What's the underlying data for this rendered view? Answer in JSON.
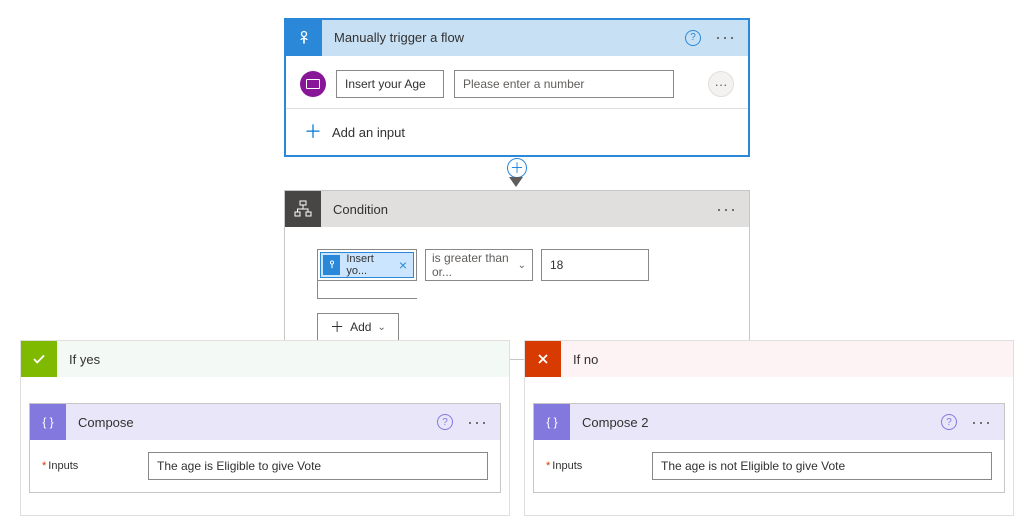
{
  "trigger": {
    "title": "Manually trigger a flow",
    "input_label": "Insert your Age",
    "input_placeholder": "Please enter a number",
    "add_input": "Add an input"
  },
  "condition": {
    "title": "Condition",
    "token": "Insert yo...",
    "operator": "is greater than or...",
    "value": "18",
    "add_label": "Add"
  },
  "branches": {
    "yes": {
      "title": "If yes",
      "compose_title": "Compose",
      "inputs_label": "Inputs",
      "inputs_value": "The age is Eligible to give Vote"
    },
    "no": {
      "title": "If no",
      "compose_title": "Compose 2",
      "inputs_label": "Inputs",
      "inputs_value": "The age is not Eligible to give Vote"
    }
  }
}
